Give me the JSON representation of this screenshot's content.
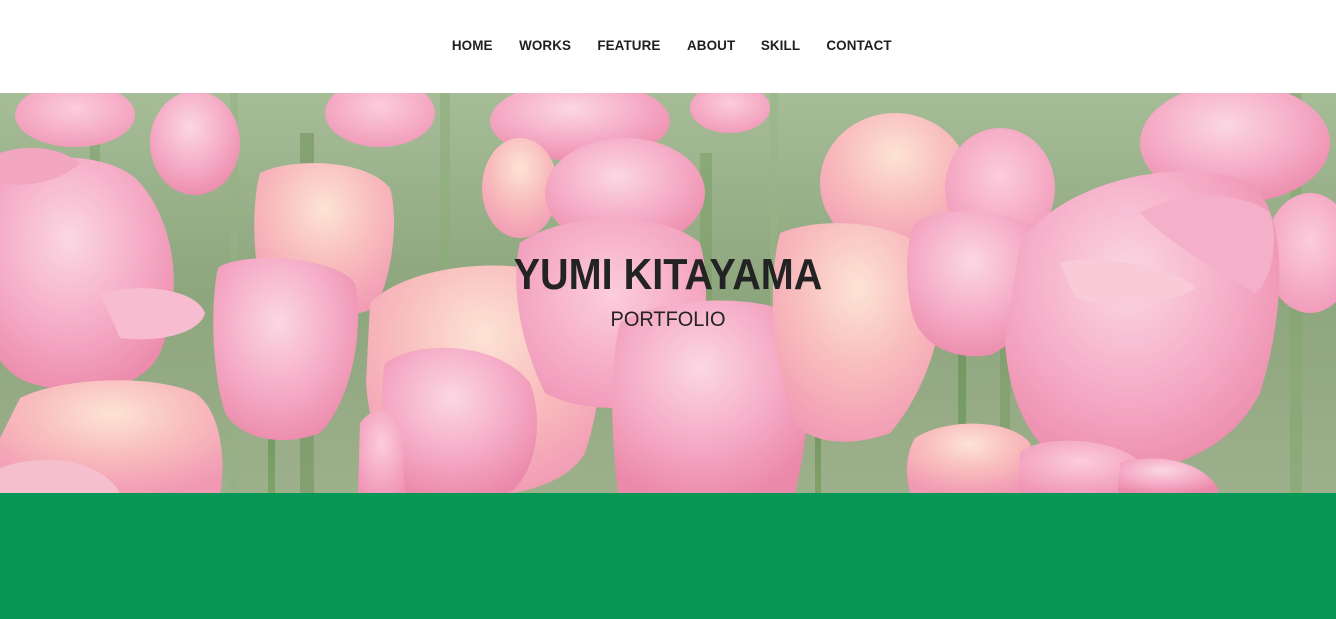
{
  "nav": {
    "items": [
      {
        "label": "HOME"
      },
      {
        "label": "WORKS"
      },
      {
        "label": "FEATURE"
      },
      {
        "label": "ABOUT"
      },
      {
        "label": "SKILL"
      },
      {
        "label": "CONTACT"
      }
    ]
  },
  "hero": {
    "title": "YUMI KITAYAMA",
    "subtitle": "PORTFOLIO",
    "image": "pink-tulip-field"
  },
  "colors": {
    "header_bg": "#ffffff",
    "nav_text": "#1f1f1f",
    "hero_text": "#232323",
    "accent_green": "#079757",
    "tulip_pink": "#f3a3c0"
  }
}
